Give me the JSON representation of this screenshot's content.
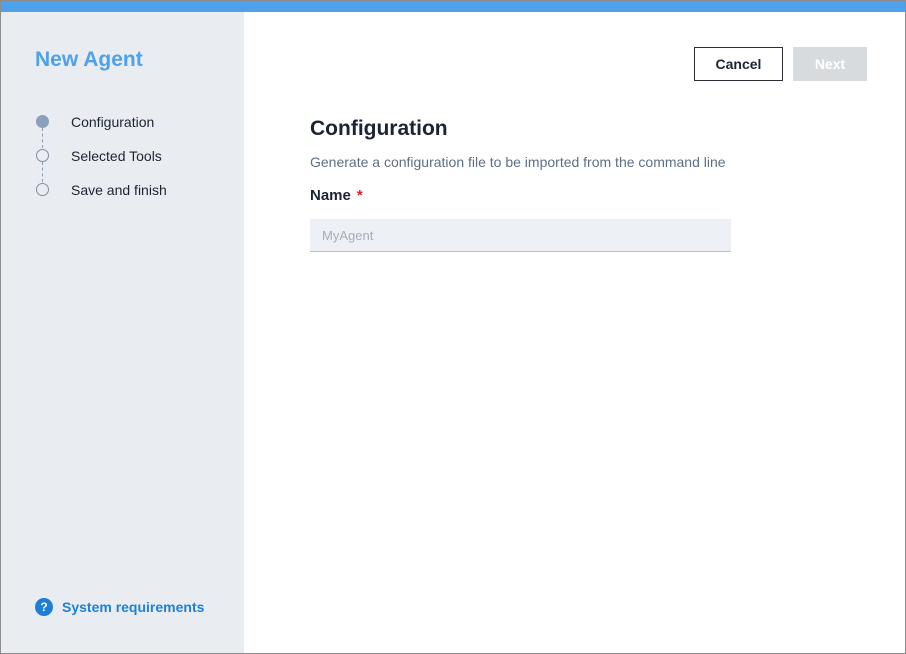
{
  "sidebar": {
    "title": "New Agent",
    "steps": [
      {
        "label": "Configuration",
        "active": true
      },
      {
        "label": "Selected Tools",
        "active": false
      },
      {
        "label": "Save and finish",
        "active": false
      }
    ],
    "help_icon": "question-mark-icon",
    "system_requirements_label": "System requirements"
  },
  "toolbar": {
    "cancel_label": "Cancel",
    "next_label": "Next"
  },
  "main": {
    "heading": "Configuration",
    "subtitle": "Generate a configuration file to be imported from the command line",
    "name_field": {
      "label": "Name",
      "required_marker": "*",
      "value": "",
      "placeholder": "MyAgent"
    }
  },
  "colors": {
    "accent": "#4ea1ea",
    "link": "#1e7fd6",
    "sidebar_bg": "#e9edf1",
    "required": "#d81f2a",
    "disabled_button": "#d8dbde"
  }
}
